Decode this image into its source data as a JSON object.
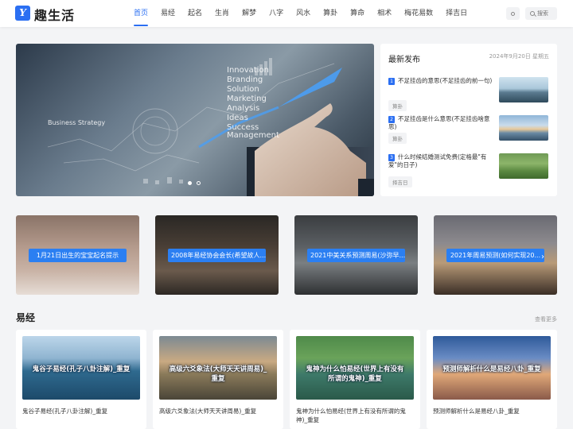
{
  "header": {
    "logo_mark": "Y",
    "site_name": "趣生活",
    "nav": [
      "首页",
      "易经",
      "起名",
      "生肖",
      "解梦",
      "八字",
      "风水",
      "算卦",
      "算命",
      "相术",
      "梅花易数",
      "择吉日"
    ],
    "active_nav": 0,
    "search_placeholder": "搜索"
  },
  "banner": {
    "words": [
      "Innovation",
      "Branding",
      "Solution",
      "Marketing",
      "Analysis",
      "Ideas",
      "Success",
      "Management",
      "Business Strategy"
    ]
  },
  "latest": {
    "title": "最新发布",
    "date": "2024年9月20日 星期五",
    "posts": [
      {
        "num": "1",
        "title": "不足挂齿的意思(不足挂齿的前一句)",
        "tag": "算卦"
      },
      {
        "num": "2",
        "title": "不足挂齿是什么意思(不足挂齿啥意思)",
        "tag": "算卦"
      },
      {
        "num": "3",
        "title": "什么时候结婚测试免费(定格最\"有爱\"的日子)",
        "tag": "择吉日"
      }
    ]
  },
  "features": [
    {
      "label": "1月21日出生的宝宝起名提示"
    },
    {
      "label": "2008年易经协会会长(希望故人..."
    },
    {
      "label": "2021中美关系预测周易(沙弥早..."
    },
    {
      "label": "2021年周易预测(如何实现20..."
    }
  ],
  "feature_arrow": "›",
  "section": {
    "title": "易经",
    "more": "查看更多",
    "cards": [
      {
        "img_text": "鬼谷子易经(孔子八卦注解)_重复",
        "title": "鬼谷子易经(孔子八卦注解)_重复"
      },
      {
        "img_text": "高级六爻象法(大师天天讲周易)_重复",
        "title": "高级六爻象法(大师天天讲周易)_重复"
      },
      {
        "img_text": "鬼神为什么怕易经(世界上有没有所谓的鬼神)_重复",
        "title": "鬼神为什么怕易经(世界上有没有所谓的鬼神)_重复"
      },
      {
        "img_text": "预测师解析什么是易经八卦_重复",
        "title": "预测师解析什么是易经八卦_重复"
      }
    ]
  },
  "colors": {
    "accent": "#2b6ff2",
    "label_bg": "#2b7ff2"
  }
}
